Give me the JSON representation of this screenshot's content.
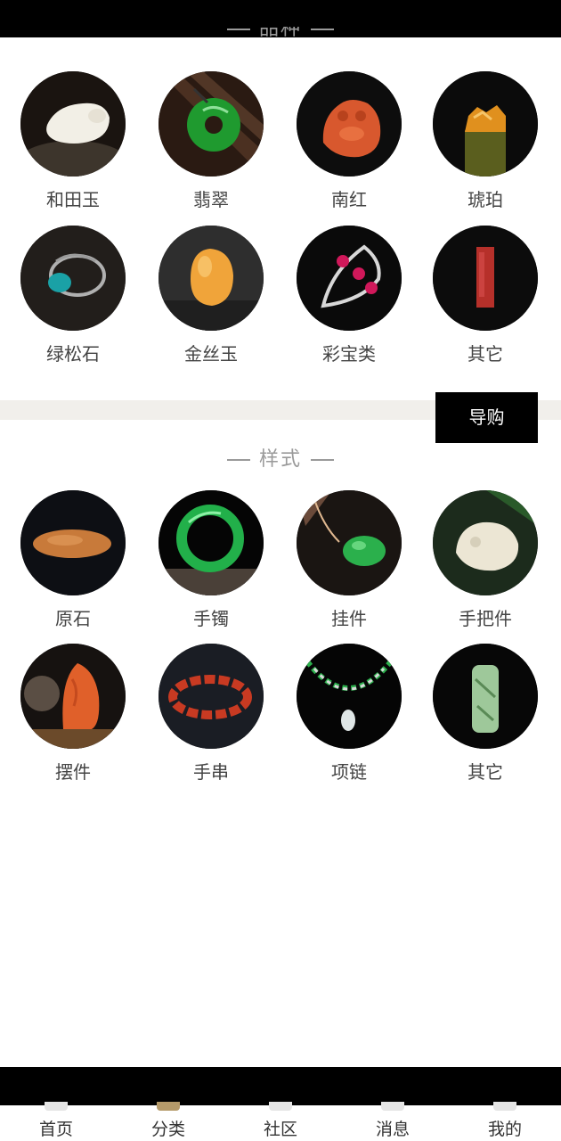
{
  "varieties": {
    "title": "品种",
    "items": [
      {
        "label": "和田玉"
      },
      {
        "label": "翡翠"
      },
      {
        "label": "南红"
      },
      {
        "label": "琥珀"
      },
      {
        "label": "绿松石"
      },
      {
        "label": "金丝玉"
      },
      {
        "label": "彩宝类"
      },
      {
        "label": "其它"
      }
    ]
  },
  "guide_button": "导购",
  "styles": {
    "title": "样式",
    "items": [
      {
        "label": "原石"
      },
      {
        "label": "手镯"
      },
      {
        "label": "挂件"
      },
      {
        "label": "手把件"
      },
      {
        "label": "摆件"
      },
      {
        "label": "手串"
      },
      {
        "label": "项链"
      },
      {
        "label": "其它"
      }
    ]
  },
  "tabbar": [
    {
      "label": "首页"
    },
    {
      "label": "分类",
      "active": true
    },
    {
      "label": "社区"
    },
    {
      "label": "消息"
    },
    {
      "label": "我的"
    }
  ],
  "colors": {
    "accent": "#b59a6a",
    "button_bg": "#000000",
    "divider": "#f1efeb"
  }
}
